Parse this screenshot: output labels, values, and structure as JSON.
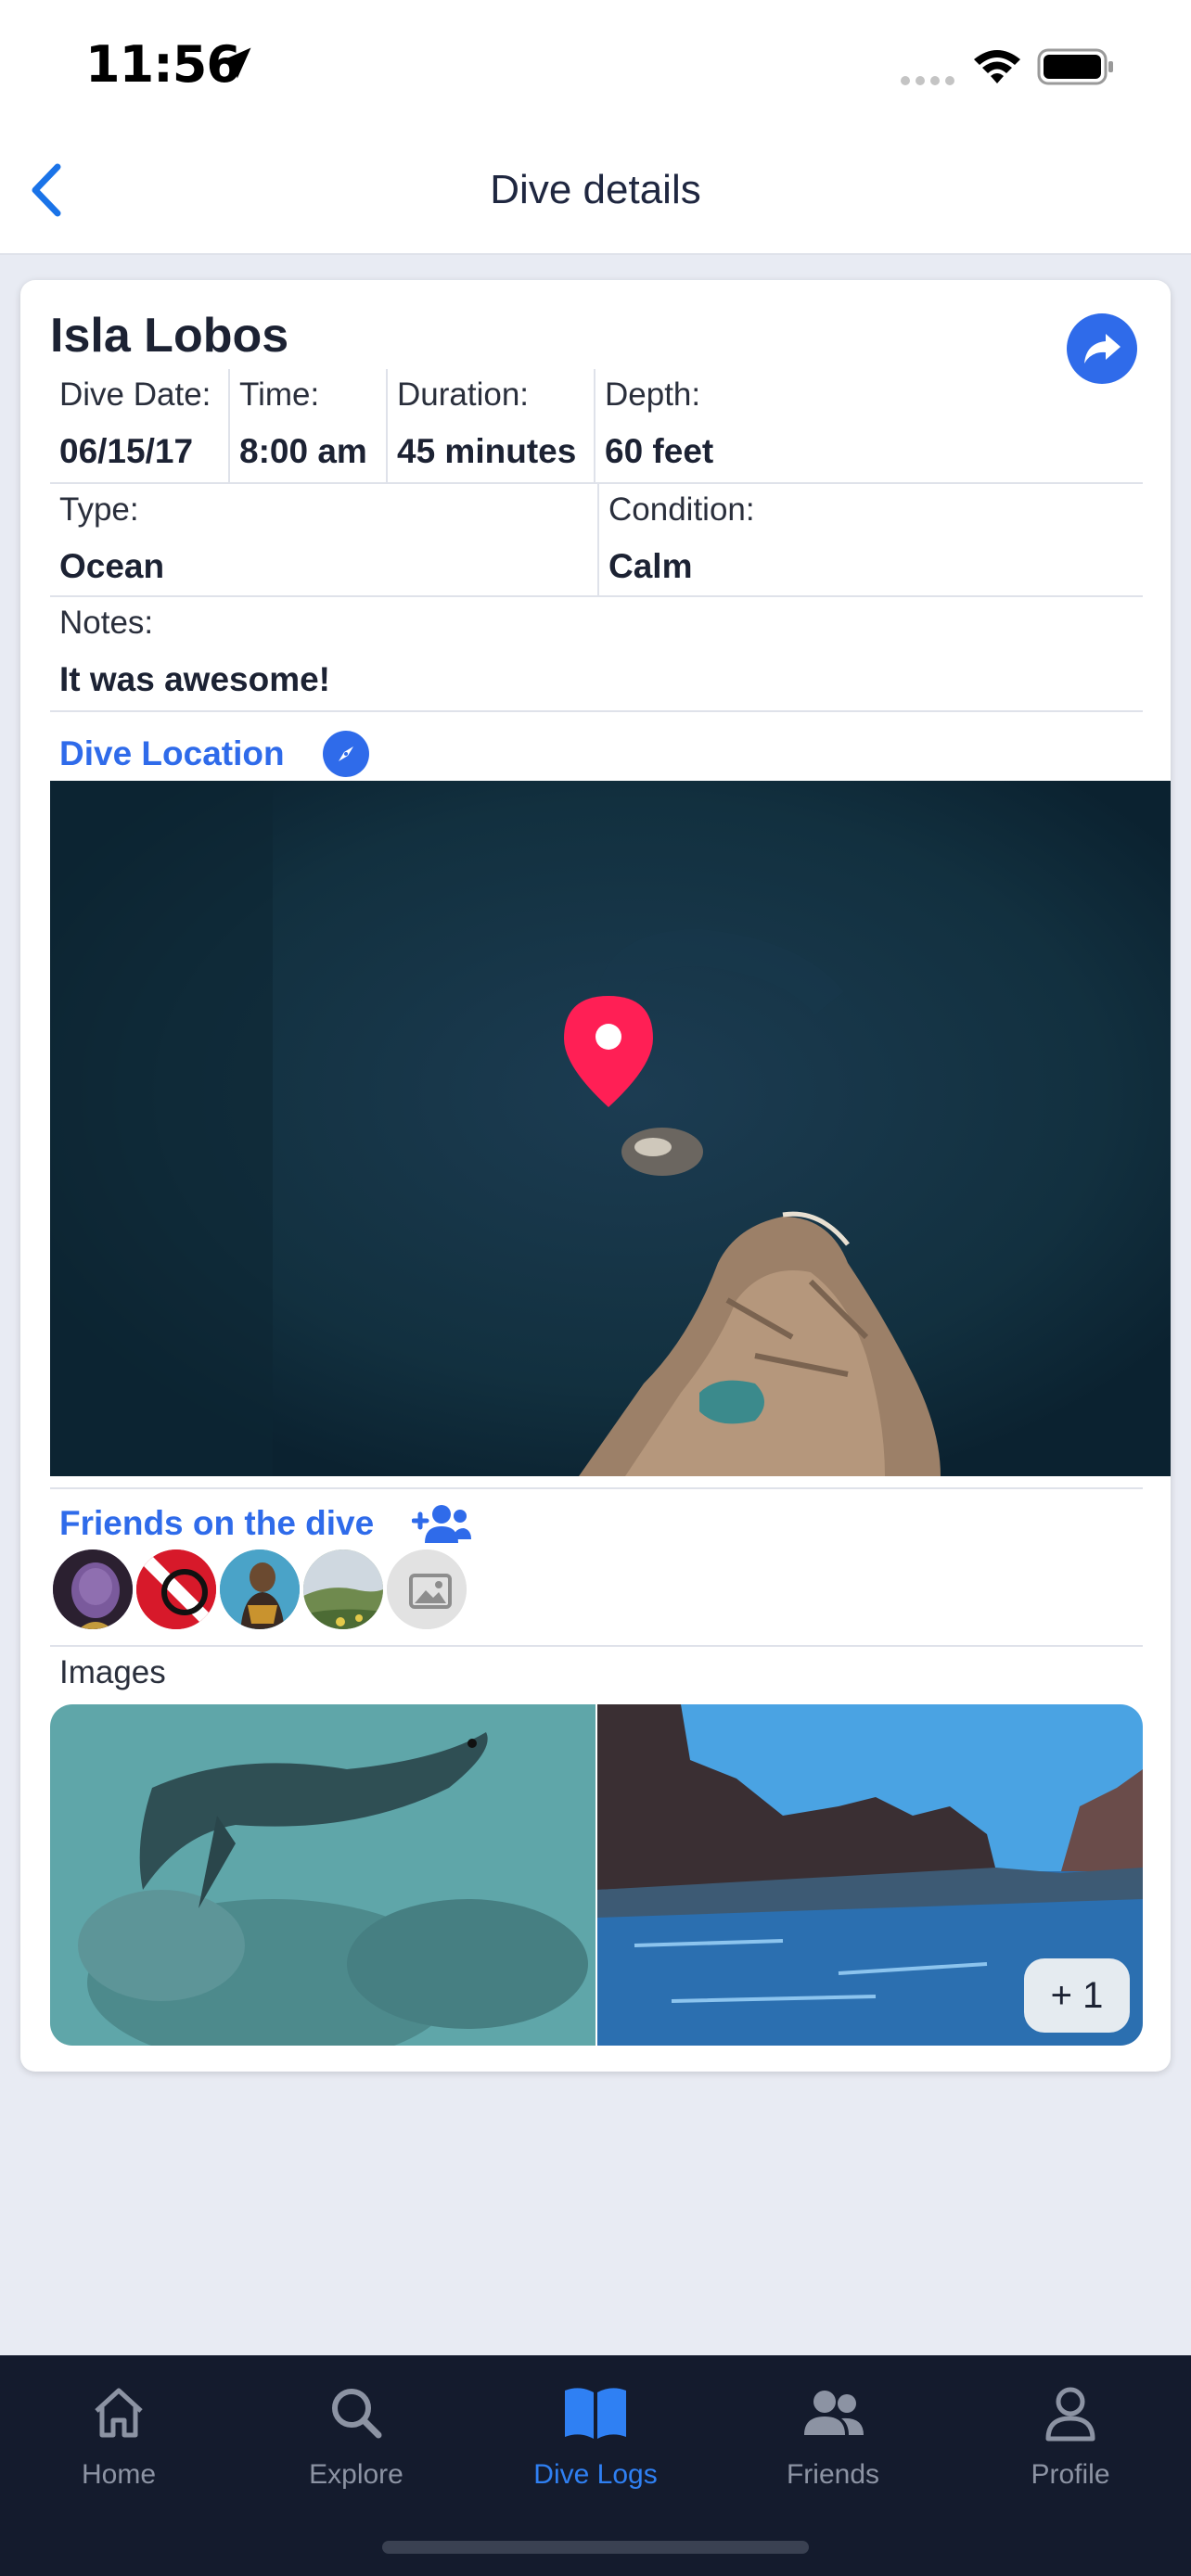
{
  "status_bar": {
    "time": "11:56"
  },
  "nav": {
    "title": "Dive details"
  },
  "dive": {
    "site_name": "Isla Lobos",
    "dive_date": {
      "label": "Dive Date:",
      "value": "06/15/17"
    },
    "time": {
      "label": "Time:",
      "value": "8:00 am"
    },
    "duration": {
      "label": "Duration:",
      "value": "45 minutes"
    },
    "depth": {
      "label": "Depth:",
      "value": "60 feet"
    },
    "type": {
      "label": "Type:",
      "value": "Ocean"
    },
    "condition": {
      "label": "Condition:",
      "value": "Calm"
    },
    "notes": {
      "label": "Notes:",
      "value": "It was awesome!"
    }
  },
  "location": {
    "label": "Dive Location"
  },
  "friends": {
    "label": "Friends on the dive",
    "avatars": [
      "avatar-villain",
      "avatar-dive-flag",
      "avatar-aquaman",
      "avatar-landscape",
      "avatar-placeholder-image"
    ]
  },
  "images": {
    "label": "Images",
    "more_count": "+ 1"
  },
  "tabs": [
    {
      "label": "Home",
      "icon": "home-icon"
    },
    {
      "label": "Explore",
      "icon": "search-icon"
    },
    {
      "label": "Dive Logs",
      "icon": "book-icon",
      "active": true
    },
    {
      "label": "Friends",
      "icon": "friends-icon"
    },
    {
      "label": "Profile",
      "icon": "profile-icon"
    }
  ],
  "colors": {
    "accent": "#2f6bea",
    "map_pin": "#ff1f55",
    "tab_bar": "#141b2d",
    "active_tab": "#2f80f3"
  }
}
